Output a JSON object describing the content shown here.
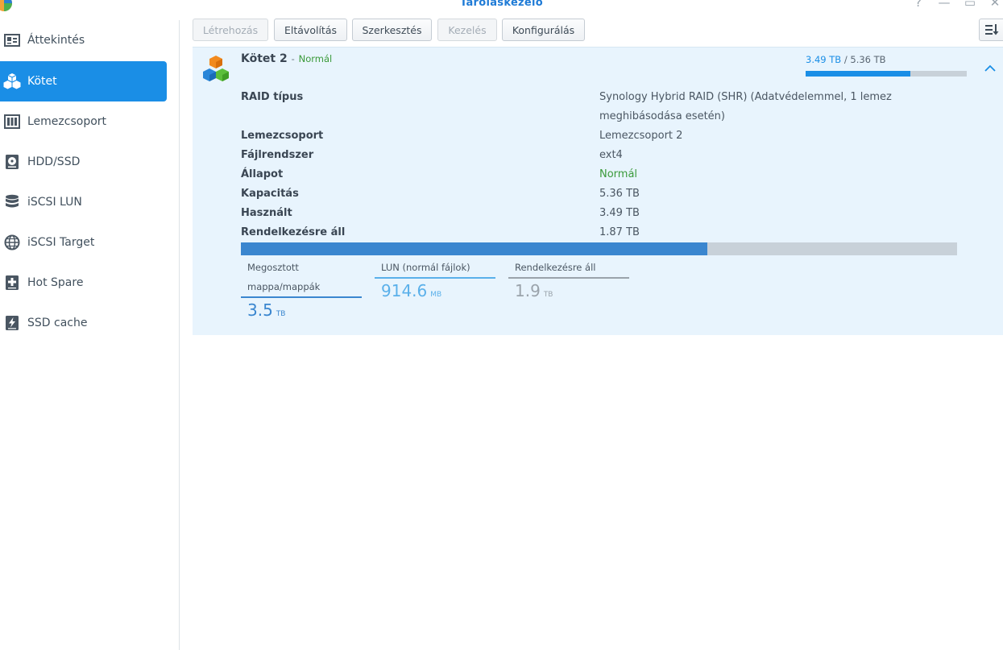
{
  "window": {
    "title": "Tároláskezelő",
    "help_glyph": "?",
    "minimize_glyph": "—",
    "maximize_glyph": "▭",
    "close_glyph": "✕"
  },
  "sidebar": {
    "items": [
      {
        "label": "Áttekintés",
        "icon": "overview-card-icon",
        "active": false
      },
      {
        "label": "Kötet",
        "icon": "cubes-icon",
        "active": true
      },
      {
        "label": "Lemezcsoport",
        "icon": "disk-group-icon",
        "active": false
      },
      {
        "label": "HDD/SSD",
        "icon": "hdd-icon",
        "active": false
      },
      {
        "label": "iSCSI LUN",
        "icon": "database-icon",
        "active": false
      },
      {
        "label": "iSCSI Target",
        "icon": "globe-icon",
        "active": false
      },
      {
        "label": "Hot Spare",
        "icon": "plus-box-icon",
        "active": false
      },
      {
        "label": "SSD cache",
        "icon": "flash-icon",
        "active": false
      }
    ]
  },
  "toolbar": {
    "create": "Létrehozás",
    "remove": "Eltávolítás",
    "edit": "Szerkesztés",
    "manage": "Kezelés",
    "configure": "Konfigurálás"
  },
  "volume": {
    "name": "Kötet 2",
    "separator": "-",
    "status": "Normál",
    "used_top": "3.49 TB",
    "slash": "/",
    "total_top": "5.36 TB",
    "usage_fraction": 0.651,
    "details": [
      {
        "label": "RAID típus",
        "value": "Synology Hybrid RAID (SHR) (Adatvédelemmel, 1 lemez meghibásodása esetén)"
      },
      {
        "label": "Lemezcsoport",
        "value": "Lemezcsoport 2"
      },
      {
        "label": "Fájlrendszer",
        "value": "ext4"
      },
      {
        "label": "Állapot",
        "value": "Normál"
      },
      {
        "label": "Kapacitás",
        "value": "5.36 TB"
      },
      {
        "label": "Használt",
        "value": "3.49 TB"
      },
      {
        "label": "Rendelkezésre áll",
        "value": "1.87 TB"
      }
    ],
    "legend": [
      {
        "label": "Megosztott mappa/mappák",
        "value": "3.5",
        "unit": "TB",
        "color": "#3a86cf"
      },
      {
        "label": "LUN (normál fájlok)",
        "value": "914.6",
        "unit": "MB",
        "color": "#5ab0ea"
      },
      {
        "label": "Rendelkezésre áll",
        "value": "1.9",
        "unit": "TB",
        "color": "#9aa3ab"
      }
    ]
  },
  "colors": {
    "accent": "#1a8ee6",
    "panel_bg": "#e8f4fd",
    "ok_green": "#3a9a3a"
  }
}
